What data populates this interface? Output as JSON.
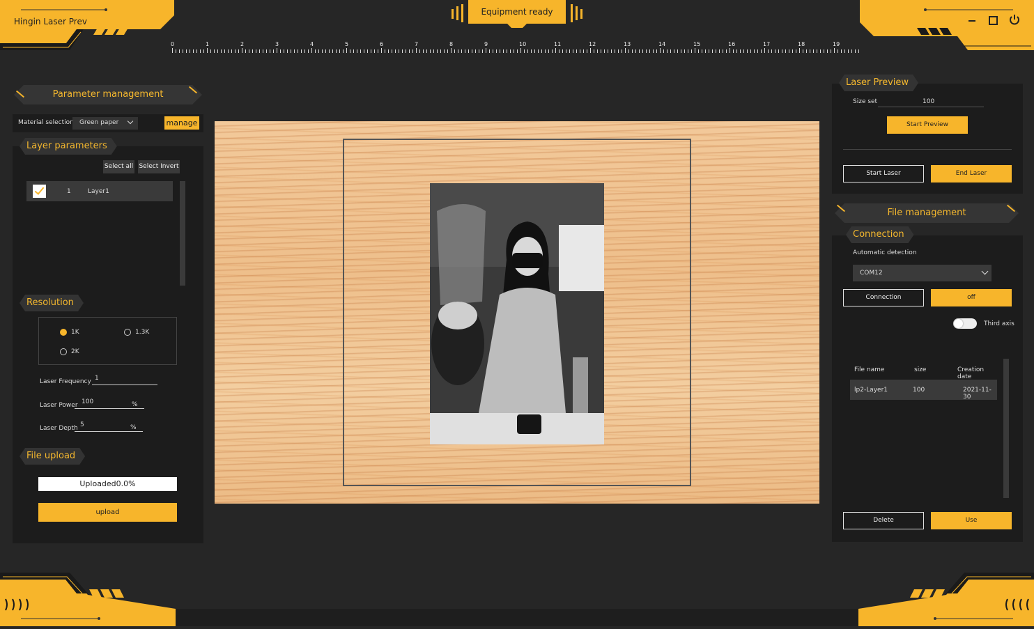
{
  "app": {
    "title": "Hingin Laser Previ",
    "status": "Equipment ready"
  },
  "window_controls": {
    "minimize": "minimize-icon",
    "maximize": "maximize-icon",
    "power": "power-icon"
  },
  "ruler": {
    "labels": [
      "0",
      "1",
      "2",
      "3",
      "4",
      "5",
      "6",
      "7",
      "8",
      "9",
      "10",
      "11",
      "12",
      "13",
      "14",
      "15",
      "16",
      "17",
      "18",
      "19"
    ]
  },
  "parameter_management": {
    "title": "Parameter management",
    "material_label": "Material selection",
    "material_value": "Green paper",
    "manage_label": "manage"
  },
  "layer_parameters": {
    "title": "Layer parameters",
    "select_all": "Select all",
    "select_invert": "Select Invert",
    "layers": [
      {
        "index": "1",
        "name": "Layer1",
        "checked": true
      }
    ]
  },
  "resolution": {
    "title": "Resolution",
    "options": [
      {
        "label": "1K",
        "selected": true
      },
      {
        "label": "1.3K",
        "selected": false
      },
      {
        "label": "2K",
        "selected": false
      }
    ],
    "frequency_label": "Laser Frequency",
    "frequency_value": "1",
    "power_label": "Laser Power",
    "power_value": "100",
    "power_unit": "%",
    "depth_label": "Laser Depth",
    "depth_value": "5",
    "depth_unit": "%"
  },
  "file_upload": {
    "title": "File upload",
    "progress_text": "Uploaded0.0%",
    "progress": 0.0,
    "upload_label": "upload"
  },
  "laser_preview": {
    "title": "Laser Preview",
    "size_label": "Size set",
    "size_value": "100",
    "start_preview": "Start Preview",
    "start_laser": "Start Laser",
    "end_laser": "End Laser"
  },
  "file_management": {
    "title": "File management",
    "connection_title": "Connection",
    "auto_detect_label": "Automatic detection",
    "port_value": "COM12",
    "connection_button": "Connection",
    "off_button": "off",
    "third_axis_label": "Third axis",
    "table": {
      "headers": [
        "File name",
        "size",
        "Creation date"
      ],
      "rows": [
        {
          "name": "lp2-Layer1",
          "size": "100",
          "date": "2021-11-30"
        }
      ]
    },
    "delete_label": "Delete",
    "use_label": "Use"
  },
  "colors": {
    "accent": "#f7b52b",
    "background": "#262626",
    "panel": "#1c1c1c"
  }
}
